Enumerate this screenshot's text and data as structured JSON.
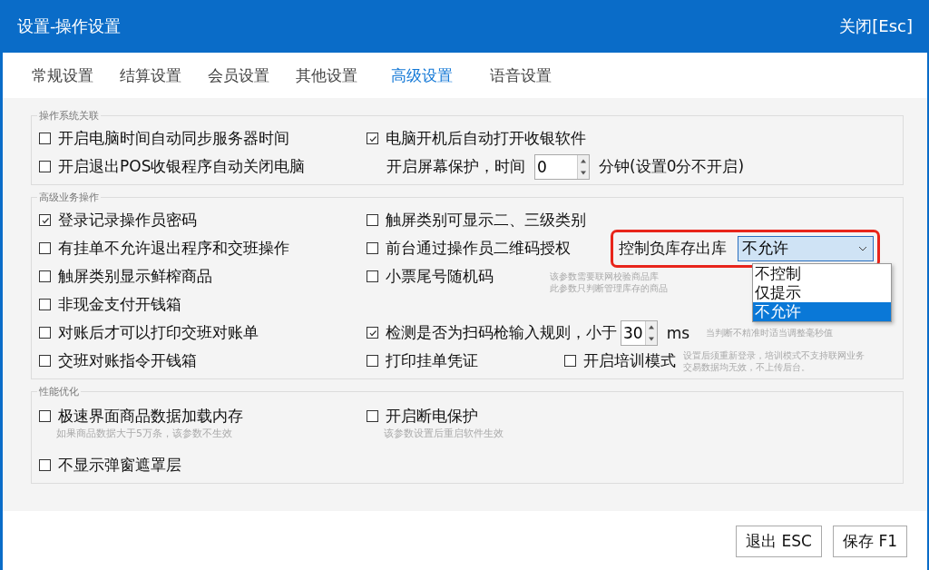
{
  "window": {
    "title": "设置-操作设置",
    "close": "关闭[Esc]"
  },
  "tabs": [
    {
      "label": "常规设置",
      "selected": false
    },
    {
      "label": "结算设置",
      "selected": false
    },
    {
      "label": "会员设置",
      "selected": false
    },
    {
      "label": "其他设置",
      "selected": false
    },
    {
      "label": "高级设置",
      "selected": true
    },
    {
      "label": "语音设置",
      "selected": false
    }
  ],
  "sections": [
    {
      "title": "操作系统关联",
      "rows": [
        [
          {
            "kind": "checkbox",
            "label": "开启电脑时间自动同步服务器时间",
            "checked": false
          },
          {
            "kind": "checkbox",
            "label": "电脑开机后自动打开收银软件",
            "checked": true
          }
        ],
        [
          {
            "kind": "checkbox",
            "label": "开启退出POS收银程序自动关闭电脑",
            "checked": false
          },
          {
            "kind": "text",
            "label": "开启屏幕保护，时间"
          },
          {
            "kind": "spinner",
            "value": "0"
          },
          {
            "kind": "text",
            "label": "分钟(设置0分不开启)"
          }
        ]
      ]
    },
    {
      "title": "高级业务操作",
      "rows": [
        [
          {
            "kind": "checkbox",
            "label": "登录记录操作员密码",
            "checked": true
          },
          {
            "kind": "checkbox",
            "label": "触屏类别可显示二、三级类别",
            "checked": false
          }
        ],
        [
          {
            "kind": "checkbox",
            "label": "有挂单不允许退出程序和交班操作",
            "checked": false
          },
          {
            "kind": "checkbox",
            "label": "前台通过操作员二维码授权",
            "checked": false
          },
          {
            "kind": "select",
            "label": "控制负库存出库",
            "value": "不允许",
            "highlighted": true,
            "expanded": true,
            "options": [
              {
                "label": "不控制",
                "selected": false
              },
              {
                "label": "仅提示",
                "selected": false
              },
              {
                "label": "不允许",
                "selected": true
              }
            ]
          }
        ],
        [
          {
            "kind": "checkbox",
            "label": "触屏类别显示鲜榨商品",
            "checked": false
          },
          {
            "kind": "checkbox",
            "label": "小票尾号随机码",
            "checked": false
          },
          {
            "kind": "hint",
            "lines": [
              "该参数需要联网校验商品库",
              "此参数只判断管理库存的商品"
            ]
          }
        ],
        [
          {
            "kind": "checkbox",
            "label": "非现金支付开钱箱",
            "checked": false
          }
        ],
        [
          {
            "kind": "checkbox",
            "label": "对账后才可以打印交班对账单",
            "checked": false
          },
          {
            "kind": "checkbox",
            "label": "检测是否为扫码枪输入规则，小于",
            "checked": true
          },
          {
            "kind": "spinner",
            "value": "30"
          },
          {
            "kind": "text",
            "label": "ms"
          },
          {
            "kind": "hint",
            "lines": [
              "当判断不精准时适当调整毫秒值"
            ]
          }
        ],
        [
          {
            "kind": "checkbox",
            "label": "交班对账指令开钱箱",
            "checked": false
          },
          {
            "kind": "checkbox",
            "label": "打印挂单凭证",
            "checked": false
          },
          {
            "kind": "checkbox",
            "label": "开启培训模式",
            "checked": false
          },
          {
            "kind": "hint",
            "lines": [
              "设置后须重新登录，培训模式不支持联网业务",
              "交易数据均无效，不上传后台。"
            ]
          }
        ]
      ]
    },
    {
      "title": "性能优化",
      "rows": [
        [
          {
            "kind": "checkbox",
            "label": "极速界面商品数据加载内存",
            "checked": false,
            "note": "如果商品数据大于5万条，该参数不生效"
          },
          {
            "kind": "checkbox",
            "label": "开启断电保护",
            "checked": false,
            "note": "该参数设置后重启软件生效"
          }
        ],
        [
          {
            "kind": "checkbox",
            "label": "不显示弹窗遮罩层",
            "checked": false
          }
        ]
      ]
    }
  ],
  "buttons": [
    "退出 ESC",
    "保存 F1"
  ]
}
